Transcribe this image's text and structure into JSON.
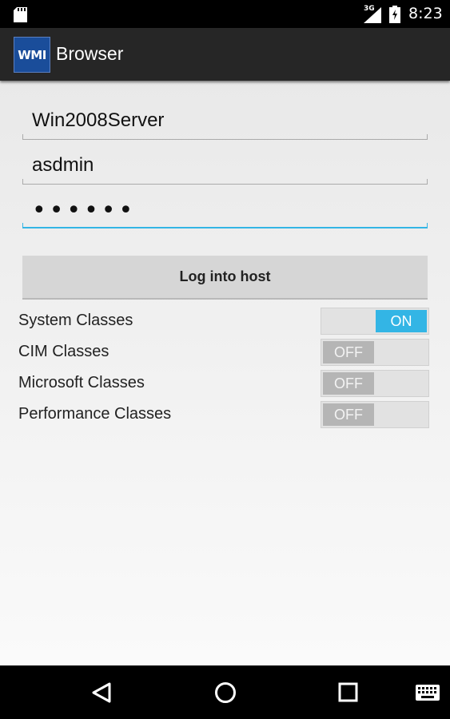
{
  "status_bar": {
    "network_type": "3G",
    "time": "8:23"
  },
  "action_bar": {
    "logo_text": "WMI",
    "title": "Browser"
  },
  "form": {
    "host_value": "Win2008Server",
    "username_value": "asdmin",
    "password_mask": "••••••",
    "login_label": "Log into host"
  },
  "toggles": [
    {
      "label": "System Classes",
      "state": "ON"
    },
    {
      "label": "CIM Classes",
      "state": "OFF"
    },
    {
      "label": "Microsoft Classes",
      "state": "OFF"
    },
    {
      "label": "Performance Classes",
      "state": "OFF"
    }
  ],
  "icons": {
    "sd_card": "sd-card-icon",
    "signal": "cell-signal-icon",
    "battery": "battery-charging-icon",
    "back": "back-icon",
    "home": "home-icon",
    "recents": "recents-icon",
    "keyboard": "keyboard-icon"
  },
  "colors": {
    "accent": "#33b5e5",
    "action_bar": "#262626",
    "logo_bg": "#1a4d9a"
  }
}
